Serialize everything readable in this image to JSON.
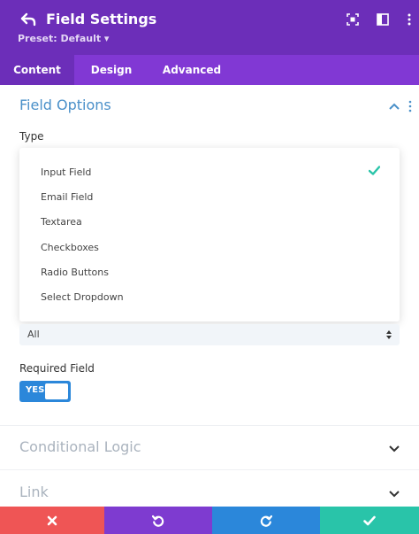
{
  "header": {
    "title": "Field Settings",
    "preset": "Preset: Default ▾",
    "icons": [
      "back-arrow-icon",
      "focus-icon",
      "split-view-icon",
      "more-icon"
    ]
  },
  "tabs": [
    {
      "label": "Content",
      "active": true
    },
    {
      "label": "Design",
      "active": false
    },
    {
      "label": "Advanced",
      "active": false
    }
  ],
  "section": {
    "title": "Field Options",
    "type_label": "Type",
    "options": [
      "Input Field",
      "Email Field",
      "Textarea",
      "Checkboxes",
      "Radio Buttons",
      "Select Dropdown"
    ],
    "selected_option": "Input Field",
    "select_value": "All",
    "required_label": "Required Field",
    "toggle_label": "YES",
    "toggle_on": true
  },
  "collapsed_sections": [
    "Conditional Logic",
    "Link"
  ],
  "bottom_bar": [
    {
      "name": "discard",
      "icon": "close-icon",
      "color": "#ef5555"
    },
    {
      "name": "undo",
      "icon": "undo-icon",
      "color": "#7e3bd0"
    },
    {
      "name": "redo",
      "icon": "redo-icon",
      "color": "#2b87da"
    },
    {
      "name": "save",
      "icon": "check-icon",
      "color": "#29c4a9"
    }
  ],
  "colors": {
    "header": "#6c2eb9",
    "tabs": "#8138d4",
    "accent_blue": "#4a90c9",
    "toggle": "#2b87da",
    "check": "#29c4a9"
  }
}
